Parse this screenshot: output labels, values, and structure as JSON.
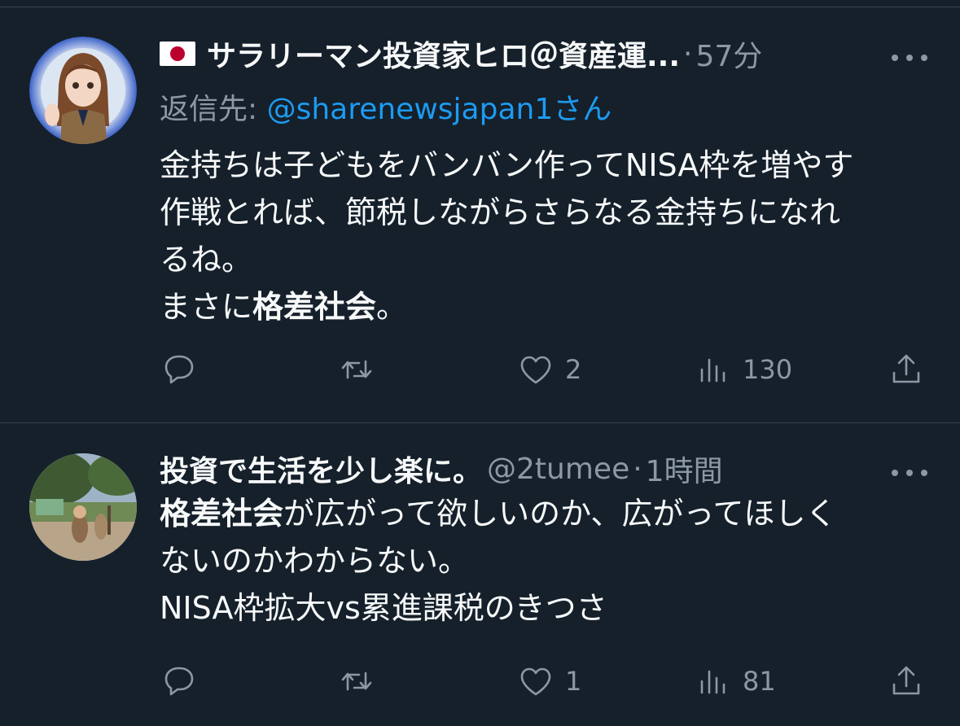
{
  "tweets": [
    {
      "name": "サラリーマン投資家ヒロ＠資産運...",
      "has_flag": true,
      "handle": "",
      "time": "57分",
      "reply_label": "返信先: ",
      "reply_mention": "@sharenewsjapan1",
      "reply_suffix": "さん",
      "body": {
        "line1": "金持ちは子どもをバンバン作ってNISA枠を増やす",
        "line2": "作戦とれば、節税しながらさらなる金持ちになれ",
        "line3": "るね。",
        "line4_prefix": "まさに",
        "line4_bold": "格差社会",
        "line4_suffix": "。"
      },
      "stats": {
        "replies": "",
        "retweets": "",
        "likes": "2",
        "views": "130"
      }
    },
    {
      "name": "投資で生活を少し楽に。",
      "has_flag": false,
      "handle": "@2tumee",
      "time": "1時間",
      "body": {
        "line1_bold": "格差社会",
        "line1_rest": "が広がって欲しいのか、広がってほしく",
        "line2": "ないのかわからない。",
        "line3": "NISA枠拡大vs累進課税のきつさ"
      },
      "stats": {
        "replies": "",
        "retweets": "",
        "likes": "1",
        "views": "81"
      }
    }
  ],
  "icons": {
    "reply": "speech-bubble-icon",
    "retweet": "retweet-arrows-icon",
    "like": "heart-outline-icon",
    "views": "bar-chart-icon",
    "share": "share-upload-icon",
    "more": "ellipsis-icon"
  },
  "colors": {
    "background": "#15202b",
    "text": "#f7f9f9",
    "secondary": "#8b98a5",
    "link": "#1d9bf0",
    "divider": "#38444d"
  }
}
